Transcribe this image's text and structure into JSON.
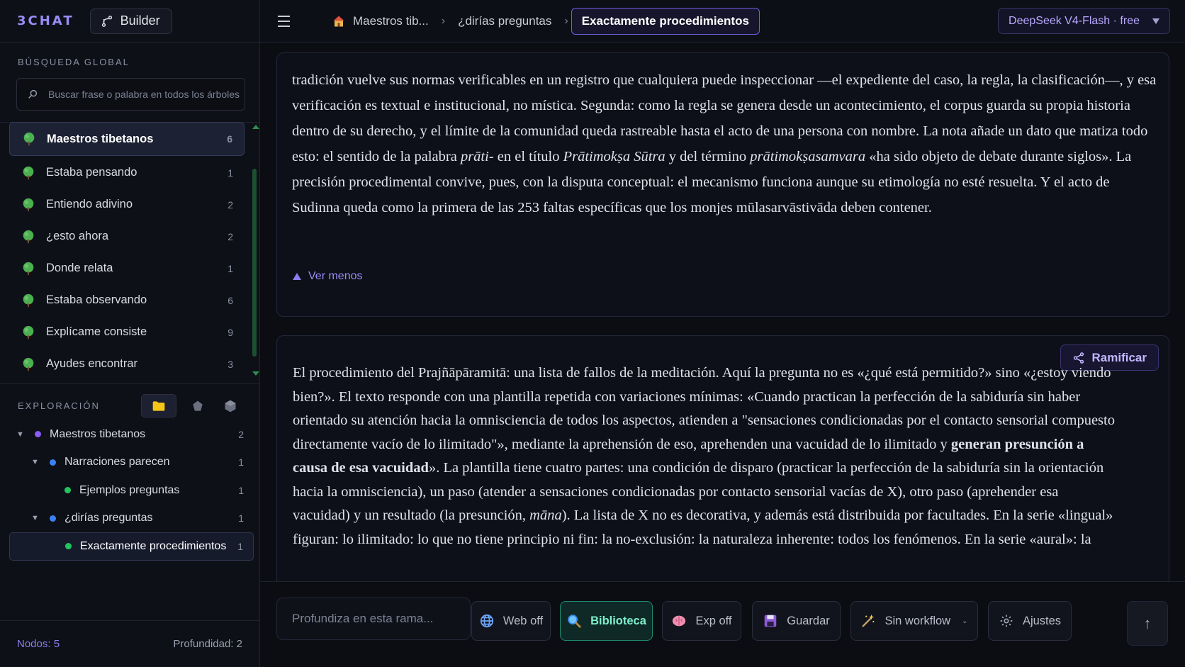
{
  "sidebar": {
    "logo": "3CHAT",
    "builder_label": "Builder",
    "search_title": "BÚSQUEDA GLOBAL",
    "search_placeholder": "Buscar frase o palabra en todos los árboles",
    "conversations": [
      {
        "name": "Maestros tibetanos",
        "count": "6",
        "active": true
      },
      {
        "name": "Estaba pensando",
        "count": "1"
      },
      {
        "name": "Entiendo adivino",
        "count": "2"
      },
      {
        "name": "¿esto ahora",
        "count": "2"
      },
      {
        "name": "Donde relata",
        "count": "1"
      },
      {
        "name": "Estaba observando",
        "count": "6"
      },
      {
        "name": "Explícame consiste",
        "count": "9"
      },
      {
        "name": "Ayudes encontrar",
        "count": "3"
      }
    ],
    "explore_title": "EXPLORACIÓN",
    "tree": [
      {
        "label": "Maestros tibetanos",
        "count": "2",
        "depth": 0,
        "caret": "▼",
        "dot": "#8b5cf6"
      },
      {
        "label": "Narraciones parecen",
        "count": "1",
        "depth": 1,
        "caret": "▼",
        "dot": "#3b82f6"
      },
      {
        "label": "Ejemplos preguntas",
        "count": "1",
        "depth": 2,
        "caret": "",
        "dot": "#22c55e"
      },
      {
        "label": "¿dirías preguntas",
        "count": "1",
        "depth": 1,
        "caret": "▼",
        "dot": "#3b82f6"
      },
      {
        "label": "Exactamente procedimientos",
        "count": "1",
        "depth": 2,
        "caret": "",
        "dot": "#22c55e",
        "active": true
      }
    ],
    "footer": {
      "nodes": "Nodos: 5",
      "depth": "Profundidad: 2"
    }
  },
  "header": {
    "breadcrumbs": [
      "Maestros tib...",
      "¿dirías preguntas",
      "Exactamente procedimientos"
    ],
    "model": "DeepSeek V4-Flash · free"
  },
  "messages": {
    "first_html": "tradición vuelve sus normas verificables en un registro que cualquiera puede inspeccionar —el expediente del caso, la regla, la clasificación—, y esa verificación es textual e institucional, no mística. Segunda: como la regla se genera desde un acontecimiento, el corpus guarda su propia historia dentro de su derecho, y el límite de la comunidad queda rastreable hasta el acto de una persona con nombre. La nota añade un dato que matiza todo esto: el sentido de la palabra <i>prāti-</i> en el título <i>Prātimokṣa Sūtra</i> y del término <i>prātimokṣasamvara</i> «ha sido objeto de debate durante siglos». La precisión procedimental convive, pues, con la disputa conceptual: el mecanismo funciona aunque su etimología no esté resuelta. Y el acto de Sudinna queda como la primera de las 253 faltas específicas que los monjes mūlasarvāstivāda deben contener.",
    "ver_menos": "Ver menos",
    "ramificar": "Ramificar",
    "second_html": "El procedimiento del Prajñāpāramitā: una lista de fallos de la meditación. Aquí la pregunta no es «¿qué está permitido?» sino «¿estoy viendo bien?». El texto responde con una plantilla repetida con variaciones mínimas: «Cuando practican la perfección de la sabiduría sin haber orientado su atención hacia la omnisciencia de todos los aspectos, atienden a \"sensaciones condicionadas por el contacto sensorial compuesto directamente vacío de lo ilimitado\"», mediante la aprehensión de eso, aprehenden una vacuidad de lo ilimitado y <b>generan presunción a causa de esa vacuidad</b>». La plantilla tiene cuatro partes: una condición de disparo (practicar la perfección de la sabiduría sin la orientación hacia la omnisciencia), un paso (atender a sensaciones condicionadas por contacto sensorial vacías de X), otro paso (aprehender esa vacuidad) y un resultado (la presunción, <i>māna</i>). La lista de X no es decorativa, y además está distribuida por facultades. En la serie «lingual» figuran: lo ilimitado: lo que no tiene principio ni fin: la no-exclusión: la naturaleza inherente: todos los fenómenos. En la serie «aural»: la"
  },
  "composer": {
    "placeholder": "Profundiza en esta rama...",
    "web": "Web off",
    "biblioteca": "Biblioteca",
    "exp": "Exp off",
    "guardar": "Guardar",
    "workflow": "Sin workflow",
    "ajustes": "Ajustes",
    "send": "↑"
  },
  "colors": {
    "accent": "#8d7ef0",
    "tree_green": "#22c55e",
    "biblioteca": "#1f8a6e"
  }
}
